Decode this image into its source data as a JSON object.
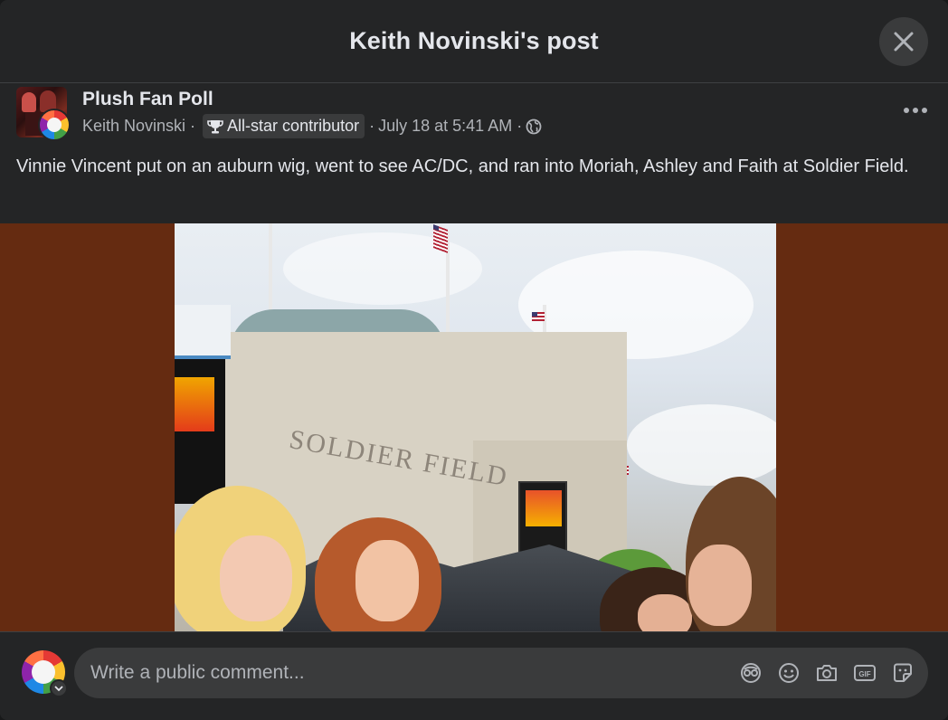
{
  "header": {
    "title": "Keith Novinski's post"
  },
  "post": {
    "page_name": "Plush Fan Poll",
    "author": "Keith Novinski",
    "badge": "All-star contributor",
    "timestamp": "July 18 at 5:41 AM",
    "audience_icon": "globe-icon",
    "text": "Vinnie Vincent put on an auburn wig, went to see AC/DC, and ran into Moriah, Ashley and Faith at Soldier Field."
  },
  "photo": {
    "engraving": "SOLDIER FIELD"
  },
  "comment": {
    "placeholder": "Write a public comment...",
    "icons": [
      "avatar-sticker-icon",
      "emoji-icon",
      "camera-icon",
      "gif-icon",
      "sticker-icon"
    ]
  },
  "colors": {
    "modal_bg": "#242526",
    "text_primary": "#e4e6eb",
    "text_secondary": "#b0b3b8",
    "input_bg": "#3a3b3c",
    "media_bg": "#652b11"
  }
}
